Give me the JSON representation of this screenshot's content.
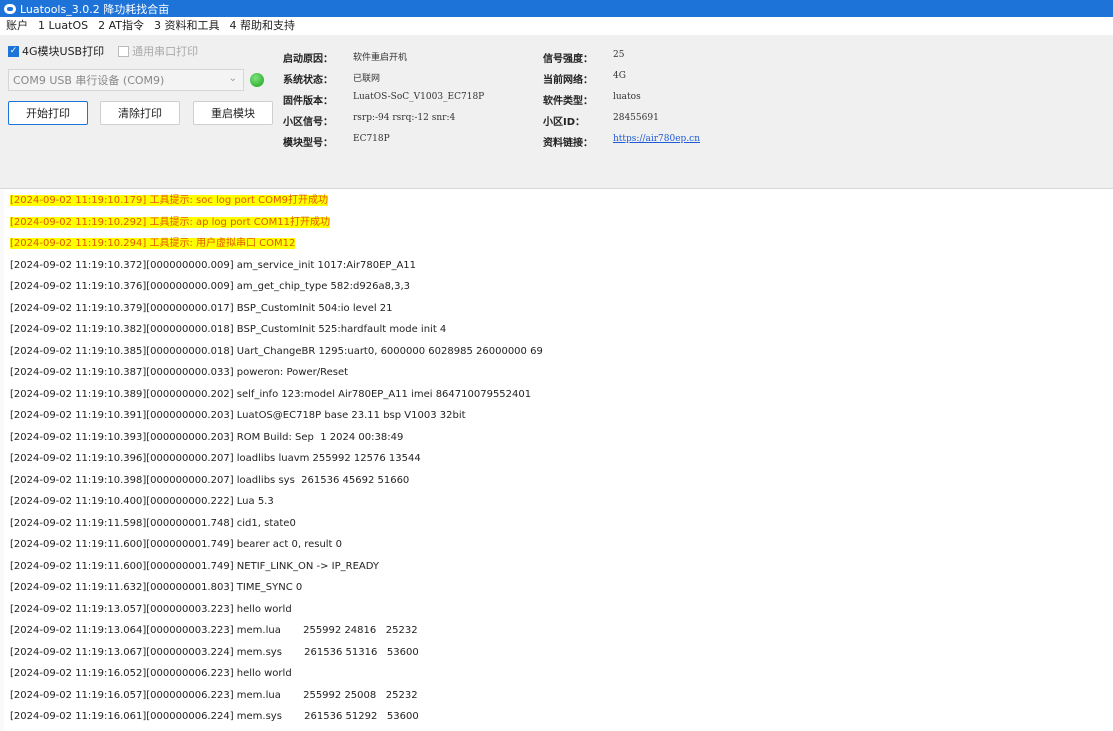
{
  "window": {
    "title": "Luatools_3.0.2 降功耗找合亩"
  },
  "menu": [
    "账户",
    "1 LuatOS",
    "2 AT指令",
    "3 资料和工具",
    "4 帮助和支持"
  ],
  "controls": {
    "cb_usb_label": "4G模块USB打印",
    "cb_serial_label": "通用串口打印",
    "port_value": "COM9 USB 串行设备 (COM9)",
    "btn_start": "开始打印",
    "btn_clear": "清除打印",
    "btn_reset": "重启模块"
  },
  "info_left": [
    {
      "key": "启动原因：",
      "value": "软件重启开机"
    },
    {
      "key": "系统状态：",
      "value": "已联网"
    },
    {
      "key": "固件版本：",
      "value": "LuatOS-SoC_V1003_EC718P"
    },
    {
      "key": "小区信号：",
      "value": "rsrp:-94 rsrq:-12 snr:4"
    },
    {
      "key": "模块型号：",
      "value": "EC718P"
    }
  ],
  "info_right": [
    {
      "key": "信号强度：",
      "value": "25"
    },
    {
      "key": "当前网络：",
      "value": "4G"
    },
    {
      "key": "软件类型：",
      "value": "luatos"
    },
    {
      "key": "小区ID：",
      "value": "28455691"
    },
    {
      "key": "资料链接：",
      "value": "https://air780ep.cn"
    }
  ],
  "log": [
    "[2024-09-02 11:19:10.179] 工具提示: soc log port COM9打开成功",
    "[2024-09-02 11:19:10.292] 工具提示: ap log port COM11打开成功",
    "[2024-09-02 11:19:10.294] 工具提示: 用户虚拟串口 COM12",
    "[2024-09-02 11:19:10.372][000000000.009] am_service_init 1017:Air780EP_A11",
    "[2024-09-02 11:19:10.376][000000000.009] am_get_chip_type 582:d926a8,3,3",
    "[2024-09-02 11:19:10.379][000000000.017] BSP_CustomInit 504:io level 21",
    "[2024-09-02 11:19:10.382][000000000.018] BSP_CustomInit 525:hardfault mode init 4",
    "[2024-09-02 11:19:10.385][000000000.018] Uart_ChangeBR 1295:uart0, 6000000 6028985 26000000 69",
    "[2024-09-02 11:19:10.387][000000000.033] poweron: Power/Reset",
    "[2024-09-02 11:19:10.389][000000000.202] self_info 123:model Air780EP_A11 imei 864710079552401",
    "[2024-09-02 11:19:10.391][000000000.203] LuatOS@EC718P base 23.11 bsp V1003 32bit",
    "[2024-09-02 11:19:10.393][000000000.203] ROM Build: Sep  1 2024 00:38:49",
    "[2024-09-02 11:19:10.396][000000000.207] loadlibs luavm 255992 12576 13544",
    "[2024-09-02 11:19:10.398][000000000.207] loadlibs sys  261536 45692 51660",
    "[2024-09-02 11:19:10.400][000000000.222] Lua 5.3",
    "[2024-09-02 11:19:11.598][000000001.748] cid1, state0",
    "[2024-09-02 11:19:11.600][000000001.749] bearer act 0, result 0",
    "[2024-09-02 11:19:11.600][000000001.749] NETIF_LINK_ON -> IP_READY",
    "[2024-09-02 11:19:11.632][000000001.803] TIME_SYNC 0",
    "[2024-09-02 11:19:13.057][000000003.223] hello world",
    "[2024-09-02 11:19:13.064][000000003.223] mem.lua       255992 24816   25232",
    "[2024-09-02 11:19:13.067][000000003.224] mem.sys       261536 51316   53600",
    "[2024-09-02 11:19:16.052][000000006.223] hello world",
    "[2024-09-02 11:19:16.057][000000006.223] mem.lua       255992 25008   25232",
    "[2024-09-02 11:19:16.061][000000006.224] mem.sys       261536 51292   53600"
  ],
  "highlight_lines": 3,
  "colors": {
    "accent": "#1e73d8",
    "highlight_bg": "#ffff00",
    "highlight_text": "#e05a00",
    "led": "#1aa31a"
  }
}
